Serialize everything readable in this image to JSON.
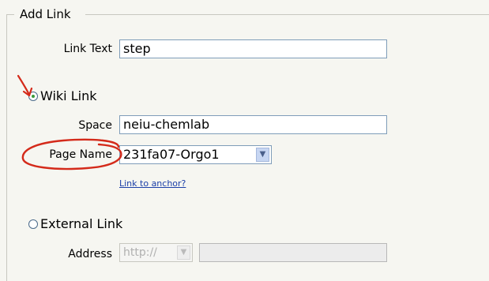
{
  "form": {
    "legend": "Add Link",
    "link_text_label": "Link Text",
    "link_text_value": "step",
    "wiki_link_label": "Wiki Link",
    "wiki_link_selected": true,
    "space_label": "Space",
    "space_value": "neiu-chemlab",
    "page_name_label": "Page Name",
    "page_name_value": "231fa07-Orgo1",
    "link_to_anchor": "Link to anchor?",
    "external_link_label": "External Link",
    "external_link_selected": false,
    "address_label": "Address",
    "address_protocol": "http://",
    "address_value": ""
  },
  "annotations": {
    "color": "#d42a1a"
  }
}
